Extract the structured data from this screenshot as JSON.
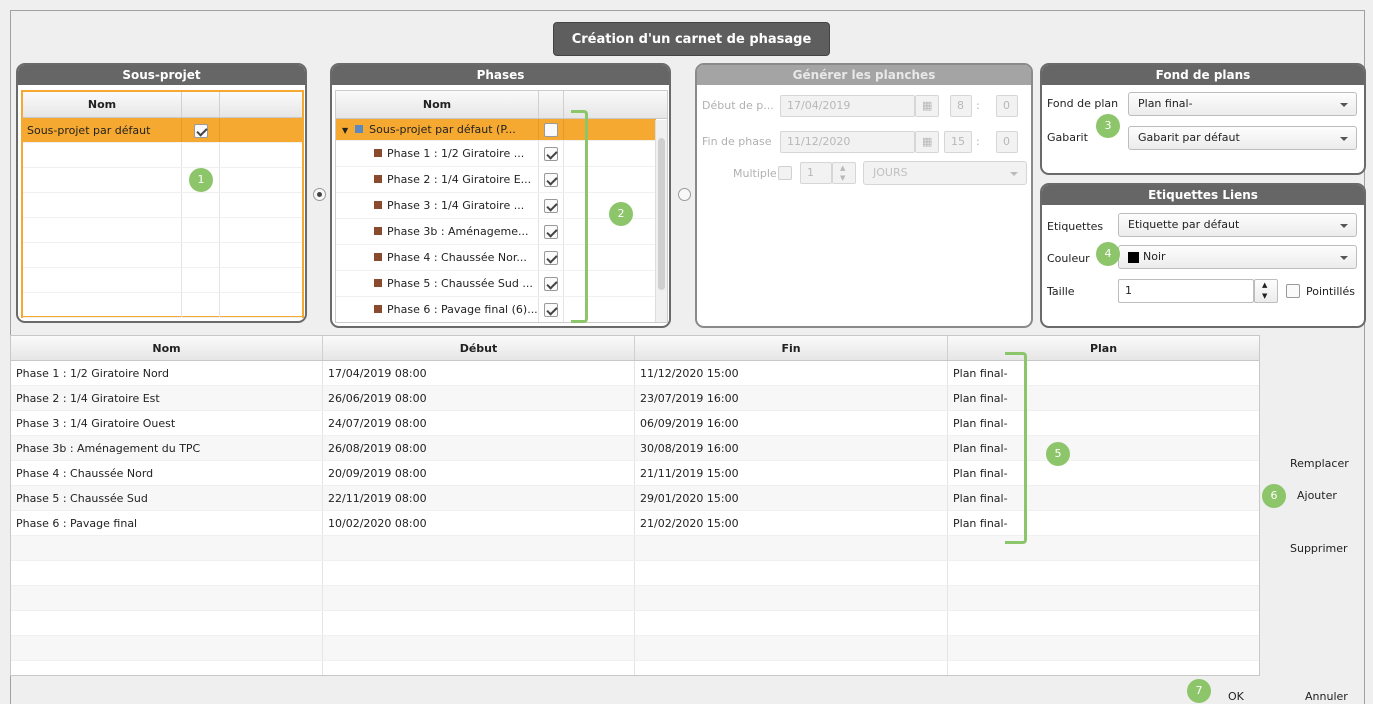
{
  "dialog": {
    "title": "Création d'un carnet de phasage"
  },
  "sousprojet": {
    "header": "Sous-projet",
    "col_nom": "Nom",
    "rows": [
      {
        "label": "Sous-projet par défaut",
        "checked": true
      }
    ]
  },
  "phases": {
    "header": "Phases",
    "col_nom": "Nom",
    "parent": "Sous-projet par défaut (P...",
    "rows": [
      {
        "label": "Phase 1 : 1/2 Giratoire ...",
        "checked": true
      },
      {
        "label": "Phase 2 : 1/4 Giratoire E...",
        "checked": true
      },
      {
        "label": "Phase 3 : 1/4 Giratoire ...",
        "checked": true
      },
      {
        "label": "Phase 3b : Aménageme...",
        "checked": true
      },
      {
        "label": "Phase 4 : Chaussée Nor...",
        "checked": true
      },
      {
        "label": "Phase 5 : Chaussée Sud ...",
        "checked": true
      },
      {
        "label": "Phase 6 : Pavage final (6)...",
        "checked": true
      }
    ]
  },
  "generer": {
    "header": "Générer les planches",
    "debut_label": "Début de p...",
    "debut_date": "17/04/2019",
    "debut_h": "8",
    "debut_m": "0",
    "fin_label": "Fin de phase",
    "fin_date": "11/12/2020",
    "fin_h": "15",
    "fin_m": "0",
    "multiple_label": "Multiple",
    "multiple_value": "1",
    "unit": "JOURS"
  },
  "fond": {
    "header": "Fond de plans",
    "fond_label": "Fond de plan",
    "fond_value": "Plan final-",
    "gabarit_label": "Gabarit",
    "gabarit_value": "Gabarit par défaut"
  },
  "etiquettes": {
    "header": "Etiquettes Liens",
    "etiq_label": "Etiquettes",
    "etiq_value": "Etiquette par défaut",
    "couleur_label": "Couleur",
    "couleur_value": "Noir",
    "couleur_color": "#000000",
    "taille_label": "Taille",
    "taille_value": "1",
    "pointilles_label": "Pointillés"
  },
  "table": {
    "headers": [
      "Nom",
      "Début",
      "Fin",
      "Plan"
    ],
    "rows": [
      [
        "Phase 1 : 1/2 Giratoire Nord",
        "17/04/2019 08:00",
        "11/12/2020 15:00",
        "Plan final-"
      ],
      [
        "Phase 2 : 1/4 Giratoire Est",
        "26/06/2019 08:00",
        "23/07/2019 16:00",
        "Plan final-"
      ],
      [
        "Phase 3 : 1/4 Giratoire Ouest",
        "24/07/2019 08:00",
        "06/09/2019 16:00",
        "Plan final-"
      ],
      [
        "Phase 3b : Aménagement du TPC",
        "26/08/2019 08:00",
        "30/08/2019 16:00",
        "Plan final-"
      ],
      [
        "Phase 4 : Chaussée Nord",
        "20/09/2019 08:00",
        "21/11/2019 15:00",
        "Plan final-"
      ],
      [
        "Phase 5 : Chaussée Sud",
        "22/11/2019 08:00",
        "29/01/2020 15:00",
        "Plan final-"
      ],
      [
        "Phase 6 : Pavage final",
        "10/02/2020 08:00",
        "21/02/2020 15:00",
        "Plan final-"
      ]
    ]
  },
  "actions": {
    "remplacer": "Remplacer",
    "ajouter": "Ajouter",
    "supprimer": "Supprimer",
    "ok": "OK",
    "annuler": "Annuler"
  },
  "callouts": [
    "1",
    "2",
    "3",
    "4",
    "5",
    "6",
    "7"
  ],
  "colors": {
    "selection": "#f6a931",
    "callout": "#8dc56b",
    "panel_head": "#666666"
  }
}
